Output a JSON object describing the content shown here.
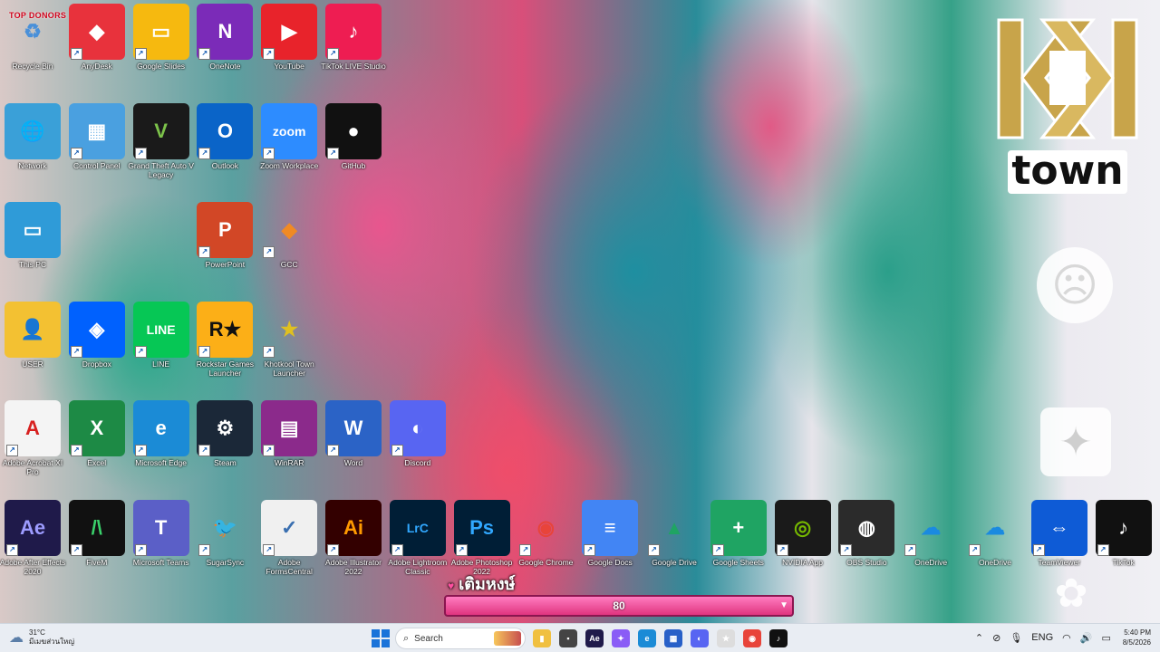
{
  "overlay": {
    "top_donors": "TOP DONORS",
    "logo_town": "town",
    "topup_label": "เติมหงษ์",
    "topup_value": "80"
  },
  "desktop_icons": [
    {
      "id": "recycle-bin",
      "label": "Recycle Bin",
      "col": 0,
      "row": 0,
      "bg": "transparent",
      "glyph": "♻",
      "color": "#4a90d9"
    },
    {
      "id": "anydesk",
      "label": "AnyDesk",
      "col": 1,
      "row": 0,
      "bg": "#e8323c",
      "glyph": "◆",
      "color": "#fff"
    },
    {
      "id": "google-slides",
      "label": "Google Slides",
      "col": 2,
      "row": 0,
      "bg": "#f6b90f",
      "glyph": "▭",
      "color": "#fff"
    },
    {
      "id": "onenote",
      "label": "OneNote",
      "col": 3,
      "row": 0,
      "bg": "#7b2bb8",
      "glyph": "N",
      "color": "#fff"
    },
    {
      "id": "youtube",
      "label": "YouTube",
      "col": 4,
      "row": 0,
      "bg": "#e8232b",
      "glyph": "▶",
      "color": "#fff"
    },
    {
      "id": "tiktok-live-studio",
      "label": "TikTok LIVE Studio",
      "col": 5,
      "row": 0,
      "bg": "#ee1d52",
      "glyph": "♪",
      "color": "#fff"
    },
    {
      "id": "network",
      "label": "Network",
      "col": 0,
      "row": 1,
      "bg": "#3aa0d8",
      "glyph": "🌐",
      "color": "#fff"
    },
    {
      "id": "control-panel",
      "label": "Control Panel",
      "col": 1,
      "row": 1,
      "bg": "#4aa0e0",
      "glyph": "▦",
      "color": "#fff"
    },
    {
      "id": "gta-v",
      "label": "Grand Theft Auto V Legacy",
      "col": 2,
      "row": 1,
      "bg": "#1a1a1a",
      "glyph": "V",
      "color": "#7cc24a"
    },
    {
      "id": "outlook",
      "label": "Outlook",
      "col": 3,
      "row": 1,
      "bg": "#0a64c8",
      "glyph": "O",
      "color": "#fff"
    },
    {
      "id": "zoom",
      "label": "Zoom Workplace",
      "col": 4,
      "row": 1,
      "bg": "#2d8cff",
      "glyph": "zoom",
      "color": "#fff"
    },
    {
      "id": "github",
      "label": "GitHub",
      "col": 5,
      "row": 1,
      "bg": "#111",
      "glyph": "●",
      "color": "#fff"
    },
    {
      "id": "this-pc",
      "label": "This PC",
      "col": 0,
      "row": 2,
      "bg": "#2f9bd8",
      "glyph": "▭",
      "color": "#fff"
    },
    {
      "id": "powerpoint",
      "label": "PowerPoint",
      "col": 3,
      "row": 2,
      "bg": "#d24726",
      "glyph": "P",
      "color": "#fff"
    },
    {
      "id": "gcc",
      "label": "GCC",
      "col": 4,
      "row": 2,
      "bg": "transparent",
      "glyph": "◆",
      "color": "#f08a24"
    },
    {
      "id": "user",
      "label": "USER",
      "col": 0,
      "row": 3,
      "bg": "#f3c132",
      "glyph": "👤",
      "color": "#fff"
    },
    {
      "id": "dropbox",
      "label": "Dropbox",
      "col": 1,
      "row": 3,
      "bg": "#0061fe",
      "glyph": "◈",
      "color": "#fff"
    },
    {
      "id": "line",
      "label": "LINE",
      "col": 2,
      "row": 3,
      "bg": "#06c755",
      "glyph": "LINE",
      "color": "#fff"
    },
    {
      "id": "rockstar",
      "label": "Rockstar Games Launcher",
      "col": 3,
      "row": 3,
      "bg": "#fcaf17",
      "glyph": "R★",
      "color": "#111"
    },
    {
      "id": "khotkool",
      "label": "Khotkool Town Launcher",
      "col": 4,
      "row": 3,
      "bg": "transparent",
      "glyph": "★",
      "color": "#e0c020"
    },
    {
      "id": "acrobat",
      "label": "Adobe Acrobat XI Pro",
      "col": 0,
      "row": 4,
      "bg": "#f4f4f4",
      "glyph": "A",
      "color": "#d7201f"
    },
    {
      "id": "excel",
      "label": "Excel",
      "col": 1,
      "row": 4,
      "bg": "#1d8a45",
      "glyph": "X",
      "color": "#fff"
    },
    {
      "id": "edge",
      "label": "Microsoft Edge",
      "col": 2,
      "row": 4,
      "bg": "#1b8bd6",
      "glyph": "e",
      "color": "#fff"
    },
    {
      "id": "steam",
      "label": "Steam",
      "col": 3,
      "row": 4,
      "bg": "#1b2838",
      "glyph": "⚙",
      "color": "#fff"
    },
    {
      "id": "winrar",
      "label": "WinRAR",
      "col": 4,
      "row": 4,
      "bg": "#8b2a8b",
      "glyph": "▤",
      "color": "#fff"
    },
    {
      "id": "word",
      "label": "Word",
      "col": 5,
      "row": 4,
      "bg": "#2b63c6",
      "glyph": "W",
      "color": "#fff"
    },
    {
      "id": "discord",
      "label": "Discord",
      "col": 6,
      "row": 4,
      "bg": "#5865f2",
      "glyph": "◐",
      "color": "#fff"
    },
    {
      "id": "after-effects",
      "label": "Adobe After Effects 2020",
      "col": 0,
      "row": 5,
      "bg": "#1f1a4a",
      "glyph": "Ae",
      "color": "#9d9cff"
    },
    {
      "id": "fivem",
      "label": "FiveM",
      "col": 1,
      "row": 5,
      "bg": "#111",
      "glyph": "/\\",
      "color": "#3ad16b"
    },
    {
      "id": "teams",
      "label": "Microsoft Teams",
      "col": 2,
      "row": 5,
      "bg": "#5b5fc7",
      "glyph": "T",
      "color": "#fff"
    },
    {
      "id": "sugarsync",
      "label": "SugarSync",
      "col": 3,
      "row": 5,
      "bg": "transparent",
      "glyph": "🐦",
      "color": "#3ab34a"
    },
    {
      "id": "formscentral",
      "label": "Adobe FormsCentral",
      "col": 4,
      "row": 5,
      "bg": "#f0f0f0",
      "glyph": "✓",
      "color": "#3a6fb0"
    },
    {
      "id": "illustrator",
      "label": "Adobe Illustrator 2022",
      "col": 5,
      "row": 5,
      "bg": "#330000",
      "glyph": "Ai",
      "color": "#ff9a00"
    },
    {
      "id": "lightroom",
      "label": "Adobe Lightroom Classic",
      "col": 6,
      "row": 5,
      "bg": "#001e36",
      "glyph": "LrC",
      "color": "#31a8ff"
    },
    {
      "id": "photoshop",
      "label": "Adobe Photoshop 2022",
      "col": 7,
      "row": 5,
      "bg": "#001e36",
      "glyph": "Ps",
      "color": "#31a8ff"
    },
    {
      "id": "chrome",
      "label": "Google Chrome",
      "col": 8,
      "row": 5,
      "bg": "transparent",
      "glyph": "◉",
      "color": "#e8443a"
    },
    {
      "id": "docs",
      "label": "Google Docs",
      "col": 9,
      "row": 5,
      "bg": "#4285f4",
      "glyph": "≡",
      "color": "#fff"
    },
    {
      "id": "drive",
      "label": "Google Drive",
      "col": 10,
      "row": 5,
      "bg": "transparent",
      "glyph": "▲",
      "color": "#1fa463"
    },
    {
      "id": "sheets",
      "label": "Google Sheets",
      "col": 11,
      "row": 5,
      "bg": "#1fa463",
      "glyph": "+",
      "color": "#fff"
    },
    {
      "id": "nvidia",
      "label": "NVIDIA App",
      "col": 12,
      "row": 5,
      "bg": "#1a1a1a",
      "glyph": "◎",
      "color": "#76b900"
    },
    {
      "id": "obs",
      "label": "OBS Studio",
      "col": 13,
      "row": 5,
      "bg": "#2b2b2b",
      "glyph": "◍",
      "color": "#fff"
    },
    {
      "id": "onedrive1",
      "label": "OneDrive",
      "col": 14,
      "row": 5,
      "bg": "transparent",
      "glyph": "☁",
      "color": "#1a8ae0"
    },
    {
      "id": "onedrive2",
      "label": "OneDrive",
      "col": 15,
      "row": 5,
      "bg": "transparent",
      "glyph": "☁",
      "color": "#1a8ae0"
    },
    {
      "id": "teamviewer",
      "label": "TeamViewer",
      "col": 16,
      "row": 5,
      "bg": "#0e5bd6",
      "glyph": "⇔",
      "color": "#fff"
    },
    {
      "id": "tiktok",
      "label": "TikTok",
      "col": 17,
      "row": 5,
      "bg": "#111",
      "glyph": "♪",
      "color": "#fff"
    }
  ],
  "taskbar": {
    "weather_temp": "31°C",
    "weather_desc": "มีเมฆส่วนใหญ่",
    "search_placeholder": "Search",
    "apps": [
      {
        "id": "file-explorer",
        "glyph": "▮",
        "bg": "#f0c040"
      },
      {
        "id": "terminal",
        "glyph": "▪",
        "bg": "#444"
      },
      {
        "id": "after-effects",
        "glyph": "Ae",
        "bg": "#1f1a4a"
      },
      {
        "id": "copilot",
        "glyph": "✦",
        "bg": "#8a5cf6"
      },
      {
        "id": "edge",
        "glyph": "e",
        "bg": "#1b8bd6"
      },
      {
        "id": "store",
        "glyph": "▦",
        "bg": "#2860c8"
      },
      {
        "id": "discord",
        "glyph": "◐",
        "bg": "#5865f2"
      },
      {
        "id": "khotkool",
        "glyph": "★",
        "bg": "#ddd"
      },
      {
        "id": "chrome",
        "glyph": "◉",
        "bg": "#e8443a"
      },
      {
        "id": "tiktok-live",
        "glyph": "♪",
        "bg": "#111"
      }
    ],
    "language": "ENG",
    "time": "5:40 PM",
    "date": "8/5/2026"
  }
}
